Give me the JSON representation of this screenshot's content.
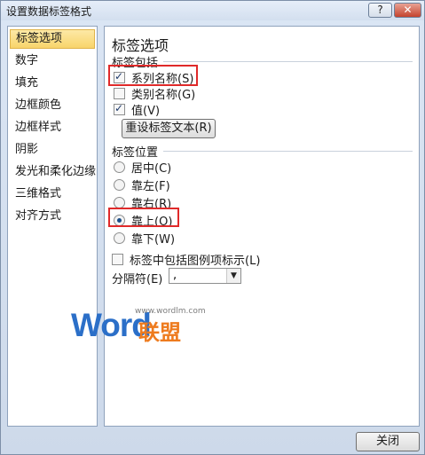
{
  "window": {
    "title": "设置数据标签格式",
    "help": "?",
    "close": "✕"
  },
  "sidebar": {
    "items": [
      {
        "label": "标签选项",
        "selected": true
      },
      {
        "label": "数字"
      },
      {
        "label": "填充"
      },
      {
        "label": "边框颜色"
      },
      {
        "label": "边框样式"
      },
      {
        "label": "阴影"
      },
      {
        "label": "发光和柔化边缘"
      },
      {
        "label": "三维格式"
      },
      {
        "label": "对齐方式"
      }
    ]
  },
  "main": {
    "heading": "标签选项",
    "contains": {
      "title": "标签包括",
      "series_name": {
        "label": "系列名称",
        "key": "(S)",
        "checked": true
      },
      "category_name": {
        "label": "类别名称",
        "key": "(G)",
        "checked": false
      },
      "value": {
        "label": "值",
        "key": "(V)",
        "checked": true
      },
      "reset_button": "重设标签文本(R)"
    },
    "position": {
      "title": "标签位置",
      "options": [
        {
          "label": "居中",
          "key": "(C)",
          "selected": false
        },
        {
          "label": "靠左",
          "key": "(F)",
          "selected": false
        },
        {
          "label": "靠右",
          "key": "(R)",
          "selected": false
        },
        {
          "label": "靠上",
          "key": "(O)",
          "selected": true
        },
        {
          "label": "靠下",
          "key": "(W)",
          "selected": false
        }
      ]
    },
    "legend_key": {
      "label": "标签中包括图例项标示",
      "key": "(L)",
      "checked": false
    },
    "separator": {
      "label": "分隔符",
      "key": "(E)",
      "value": ","
    }
  },
  "footer": {
    "close_button": "关闭"
  },
  "watermark": {
    "brand": "Word",
    "cn": "联盟",
    "url": "www.wordlm.com"
  },
  "colors": {
    "highlight": "#e02a2a",
    "selected_item": "#f8d46a",
    "accent": "#2b6fc8"
  }
}
